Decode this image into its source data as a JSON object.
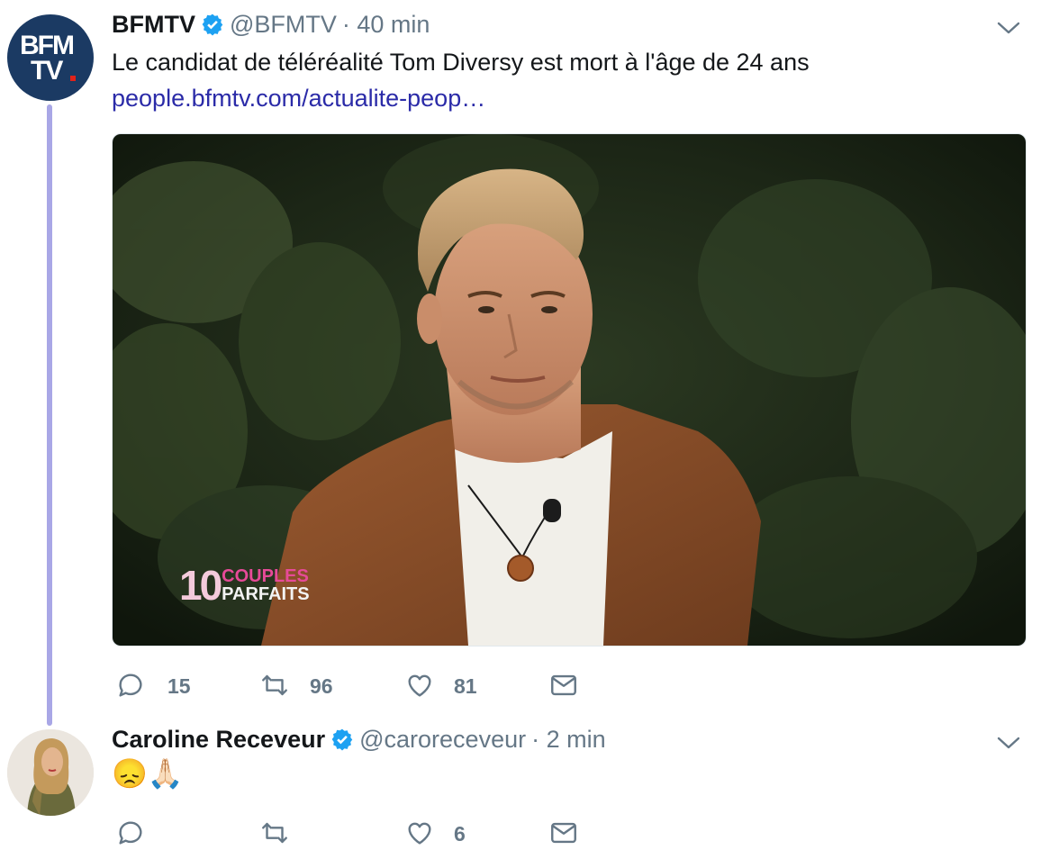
{
  "tweets": [
    {
      "avatar_text_line1": "BFM",
      "avatar_text_line2": "TV",
      "name": "BFMTV",
      "handle": "@BFMTV",
      "time": "· 40 min",
      "text": "Le candidat de téléréalité Tom Diversy est mort à l'âge de 24 ans",
      "link": "people.bfmtv.com/actualite-peop…",
      "media_logo_number": "10",
      "media_logo_line1": "COUPLES",
      "media_logo_line2": "PARFAITS",
      "actions": {
        "replies": "15",
        "retweets": "96",
        "likes": "81"
      }
    },
    {
      "name": "Caroline Receveur",
      "handle": "@caroreceveur",
      "time": "· 2 min",
      "text": "😞🙏🏻",
      "actions": {
        "replies": "",
        "retweets": "",
        "likes": "6"
      }
    }
  ],
  "colors": {
    "accent": "#1da1f2",
    "thread": "#a9a7e6",
    "link": "#2b2ba8",
    "muted": "#657786"
  },
  "icons": [
    "verified-badge-icon",
    "chevron-down-icon",
    "reply-icon",
    "retweet-icon",
    "like-icon",
    "message-icon"
  ]
}
